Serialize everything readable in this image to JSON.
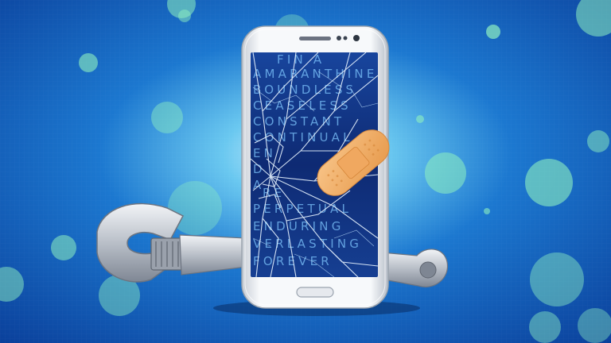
{
  "scene": {
    "subject": "smartphone-with-cracked-screen",
    "colors": {
      "background_dark": "#0a3f9a",
      "background_glow": "#d9f3ff",
      "bokeh": "#8ef0c0",
      "phone_body": "#f2f4f7",
      "screen": "#0e2a73",
      "screen_text": "#7fc7ff",
      "bandage": "#f3b069",
      "wrench": "#c9ced6"
    },
    "screen_words": [
      "FIN A",
      "AMARANTHINE",
      "BOUNDLESS",
      "CEASELESS",
      "CONSTANT",
      "CONTINUAL",
      "EN",
      "D",
      "A",
      "RE",
      "PERPETUAL",
      "ENDURING",
      "VERLASTING",
      "FOREVER"
    ]
  }
}
